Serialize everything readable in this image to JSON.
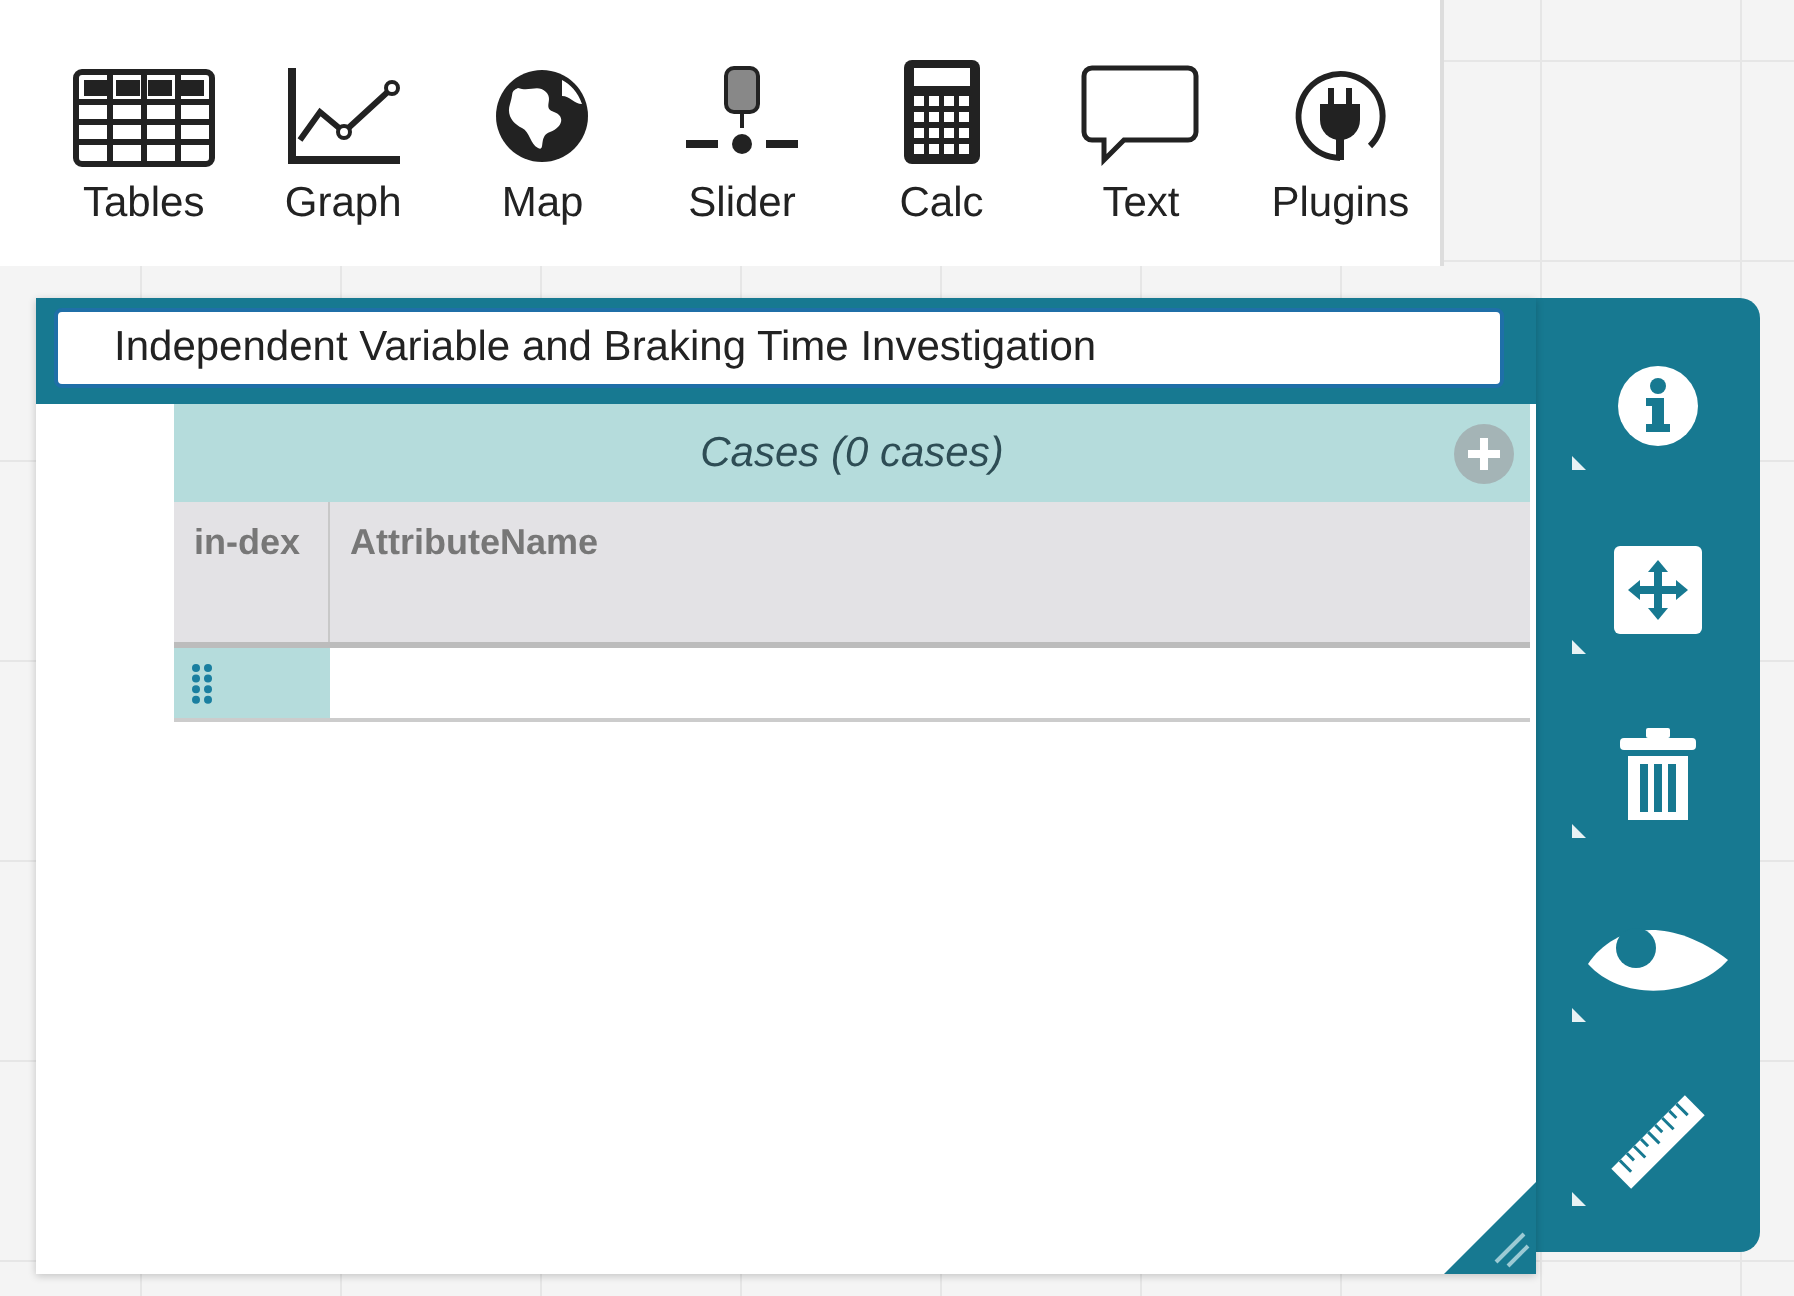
{
  "toolbar": {
    "items": [
      {
        "kind": "tables",
        "label": "Tables"
      },
      {
        "kind": "graph",
        "label": "Graph"
      },
      {
        "kind": "map",
        "label": "Map"
      },
      {
        "kind": "slider",
        "label": "Slider"
      },
      {
        "kind": "calc",
        "label": "Calc"
      },
      {
        "kind": "text",
        "label": "Text"
      },
      {
        "kind": "plugins",
        "label": "Plugins"
      }
    ]
  },
  "component": {
    "title": "Independent Variable and Braking Time Investigation",
    "table": {
      "collection": "Cases (0 cases)",
      "columns": [
        "in-dex",
        "AttributeName"
      ]
    }
  },
  "inspector": {
    "tools": [
      {
        "kind": "info"
      },
      {
        "kind": "scale"
      },
      {
        "kind": "delete"
      },
      {
        "kind": "hide"
      },
      {
        "kind": "ruler"
      }
    ]
  }
}
